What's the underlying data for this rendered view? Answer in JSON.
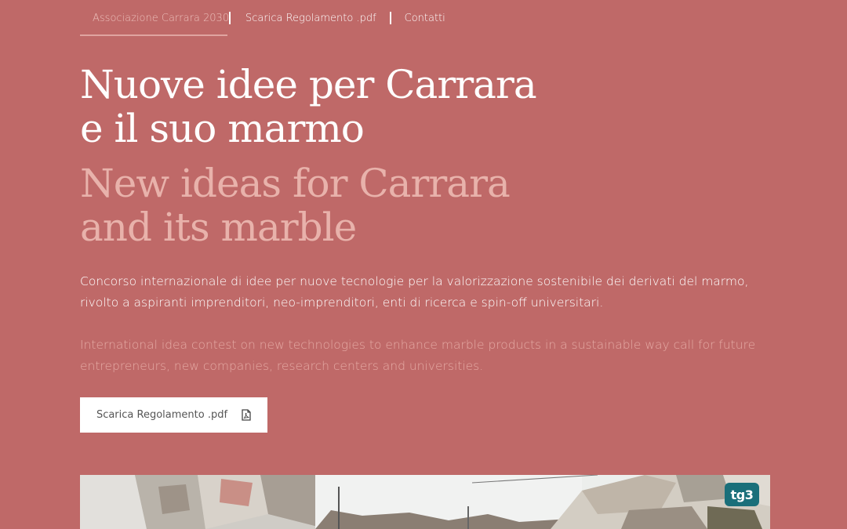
{
  "nav": {
    "items": [
      {
        "label": "Associazione Carrara 2030",
        "active": true
      },
      {
        "label": "Scarica Regolamento .pdf"
      },
      {
        "label": "Contatti"
      }
    ]
  },
  "hero": {
    "title_it_line1": "Nuove idee per Carrara",
    "title_it_line2": "e il suo marmo",
    "title_en_line1": "New ideas for Carrara",
    "title_en_line2": "and its marble",
    "desc_it": "Concorso internazionale di idee per nuove tecnologie per la valorizzazione sostenibile dei derivati del marmo, rivolto a aspiranti imprenditori, neo-imprenditori, enti di ricerca e spin-off universitari.",
    "desc_en": "International idea contest on new technologies to enhance marble products in a sustainable way call for future entrepreneurs, new companies, research centers and universities."
  },
  "download_button": {
    "label": "Scarica Regolamento .pdf",
    "icon": "pdf-file-icon"
  },
  "video": {
    "logo": "tg3"
  },
  "colors": {
    "background": "#bf6968",
    "title_en": "#e8b2ab",
    "text_en": "#e5aaa4",
    "nav_active": "#ecc0bb",
    "tg3_logo": "#1a6f7a"
  }
}
